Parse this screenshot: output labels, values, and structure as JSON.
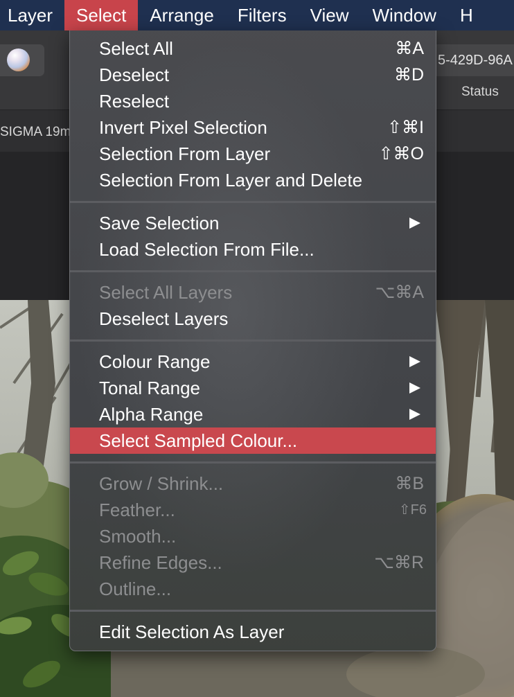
{
  "menubar": {
    "items": [
      "Layer",
      "Select",
      "Arrange",
      "Filters",
      "View",
      "Window",
      "H"
    ],
    "active_index": 1
  },
  "toolbar": {
    "document_id": "5-429D-96A",
    "status_header": "Status",
    "lens_label": "SIGMA 19m"
  },
  "select_menu": {
    "groups": [
      [
        {
          "label": "Select All",
          "shortcut": "⌘A",
          "enabled": true
        },
        {
          "label": "Deselect",
          "shortcut": "⌘D",
          "enabled": true
        },
        {
          "label": "Reselect",
          "shortcut": "",
          "enabled": true
        },
        {
          "label": "Invert Pixel Selection",
          "shortcut": "⇧⌘I",
          "enabled": true
        },
        {
          "label": "Selection From Layer",
          "shortcut": "⇧⌘O",
          "enabled": true
        },
        {
          "label": "Selection From Layer and Delete",
          "shortcut": "",
          "enabled": true
        }
      ],
      [
        {
          "label": "Save Selection",
          "submenu": true,
          "enabled": true
        },
        {
          "label": "Load Selection From File...",
          "shortcut": "",
          "enabled": true
        }
      ],
      [
        {
          "label": "Select All Layers",
          "shortcut": "⌥⌘A",
          "enabled": false
        },
        {
          "label": "Deselect Layers",
          "shortcut": "",
          "enabled": true
        }
      ],
      [
        {
          "label": "Colour Range",
          "submenu": true,
          "enabled": true
        },
        {
          "label": "Tonal Range",
          "submenu": true,
          "enabled": true
        },
        {
          "label": "Alpha Range",
          "submenu": true,
          "enabled": true
        },
        {
          "label": "Select Sampled Colour...",
          "shortcut": "",
          "enabled": true,
          "highlighted": true
        }
      ],
      [
        {
          "label": "Grow / Shrink...",
          "shortcut": "⌘B",
          "enabled": false
        },
        {
          "label": "Feather...",
          "shortcut": "⇧F6",
          "enabled": false
        },
        {
          "label": "Smooth...",
          "shortcut": "",
          "enabled": false
        },
        {
          "label": "Refine Edges...",
          "shortcut": "⌥⌘R",
          "enabled": false
        },
        {
          "label": "Outline...",
          "shortcut": "",
          "enabled": false
        }
      ],
      [
        {
          "label": "Edit Selection As Layer",
          "shortcut": "",
          "enabled": true
        }
      ]
    ]
  },
  "colors": {
    "menubar_bg": "#1f3050",
    "active_menu": "#c8444b",
    "highlight": "#c9484e",
    "menu_bg": "#424448",
    "disabled_text": "#8d8e90"
  }
}
